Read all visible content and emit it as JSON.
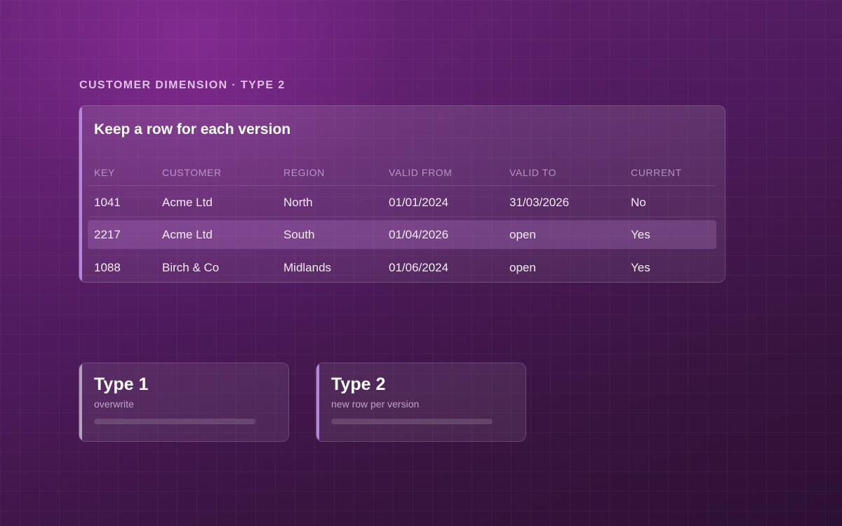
{
  "eyebrow": "CUSTOMER DIMENSION · TYPE 2",
  "table": {
    "title": "Keep a row for each version",
    "columns": [
      "KEY",
      "CUSTOMER",
      "REGION",
      "VALID FROM",
      "VALID TO",
      "CURRENT"
    ],
    "rows": [
      [
        "1041",
        "Acme Ltd",
        "North",
        "01/01/2024",
        "31/03/2026",
        "No"
      ],
      [
        "2217",
        "Acme Ltd",
        "South",
        "01/04/2026",
        "open",
        "Yes"
      ],
      [
        "1088",
        "Birch & Co",
        "Midlands",
        "01/06/2024",
        "open",
        "Yes"
      ]
    ],
    "highlighted_row": 1
  },
  "types": [
    {
      "name": "Type 1",
      "description": "overwrite"
    },
    {
      "name": "Type 2",
      "description": "new row per version"
    }
  ],
  "colors": {
    "accent": "#b486e0",
    "row_highlight": "#7a4a8e"
  }
}
